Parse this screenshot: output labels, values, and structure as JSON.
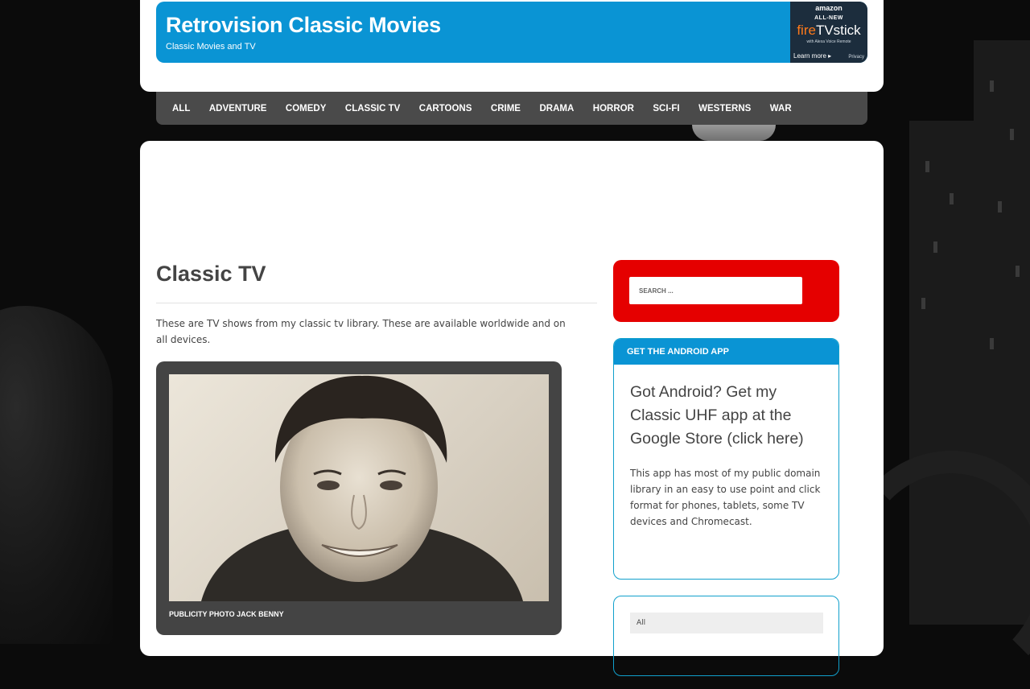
{
  "site": {
    "title": "Retrovision Classic Movies",
    "tagline": "Classic Movies and TV"
  },
  "ad": {
    "brand": "amazon",
    "all_new": "ALL-NEW",
    "product_fire": "fire",
    "product_rest": "TVstick",
    "sub": "with Alexa Voice Remote",
    "learn_more": "Learn more ▸",
    "privacy": "Privacy"
  },
  "nav": {
    "items": [
      "ALL",
      "ADVENTURE",
      "COMEDY",
      "CLASSIC TV",
      "CARTOONS",
      "CRIME",
      "DRAMA",
      "HORROR",
      "SCI-FI",
      "WESTERNS",
      "WAR"
    ]
  },
  "main": {
    "page_title": "Classic TV",
    "intro": "These are TV shows from my classic tv library. These are available worldwide and on all devices.",
    "post": {
      "caption": "PUBLICITY PHOTO JACK BENNY"
    }
  },
  "sidebar": {
    "search": {
      "placeholder": "SEARCH ..."
    },
    "android_widget": {
      "header": "GET THE ANDROID APP",
      "link": "Got Android? Get my Classic UHF app at the Google Store (click here)",
      "text": "This app has most of my public domain library in an easy to use point and click format for phones, tablets, some TV devices and Chromecast."
    },
    "categories_widget": {
      "selected": "All"
    }
  },
  "colors": {
    "accent_blue": "#0a94d4",
    "search_red": "#e50000",
    "nav_gray": "#4a4a4a",
    "background": "#0b0b0b"
  }
}
